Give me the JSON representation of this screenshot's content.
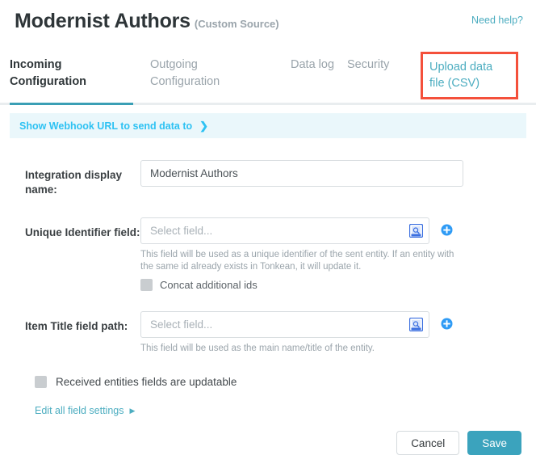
{
  "header": {
    "title": "Modernist Authors",
    "subtitle": "(Custom Source)",
    "need_help": "Need help?"
  },
  "tabs": [
    {
      "label": "Incoming Configuration",
      "active": true
    },
    {
      "label": "Outgoing Configuration",
      "active": false
    },
    {
      "label": "Data log",
      "active": false
    },
    {
      "label": "Security",
      "active": false
    },
    {
      "label": "Upload data file (CSV)",
      "active": false,
      "highlighted": true
    }
  ],
  "webhook": {
    "label": "Show Webhook URL to send data to",
    "chevron": "❯"
  },
  "form": {
    "display_name": {
      "label": "Integration display name:",
      "value": "Modernist Authors",
      "placeholder": "Integration display name"
    },
    "unique_identifier": {
      "label": "Unique Identifier field:",
      "value": "",
      "placeholder": "Select field...",
      "helper": "This field will be used as a unique identifier of the sent entity. If an entity with the same id already exists in Tonkean, it will update it.",
      "concat_label": "Concat additional ids"
    },
    "item_title": {
      "label": "Item Title field path:",
      "value": "",
      "placeholder": "Select field...",
      "helper": "This field will be used as the main name/title of the entity."
    },
    "updatable_label": "Received entities fields are updatable",
    "edit_all_label": "Edit all field settings",
    "edit_all_caret": "▶"
  },
  "footer": {
    "cancel": "Cancel",
    "save": "Save"
  },
  "colors": {
    "accent_teal": "#3ba3bd",
    "link_cyan": "#2ec2f3",
    "highlight_red": "#f4503b",
    "banner_bg": "#eaf7fb"
  }
}
